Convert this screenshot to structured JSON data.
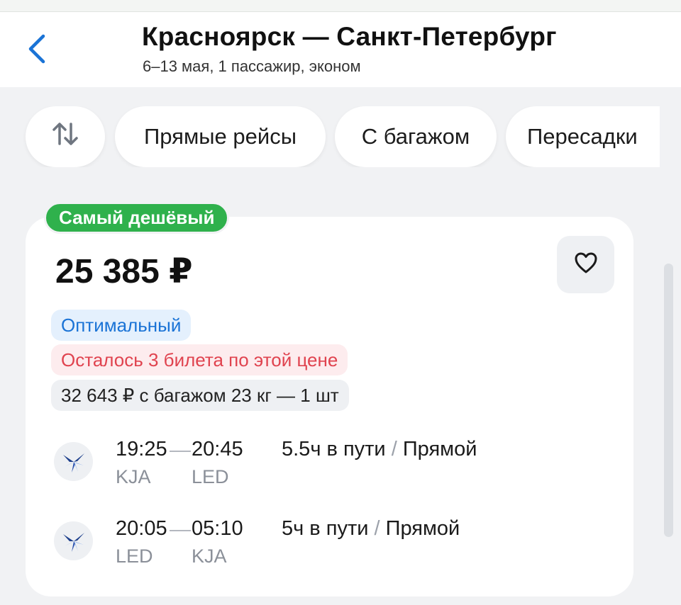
{
  "header": {
    "title": "Красноярск — Санкт-Петербург",
    "subtitle": "6–13 мая, 1 пассажир, эконом",
    "back_icon": "chevron-left-icon"
  },
  "filters": {
    "sort_icon": "sort-arrows-icon",
    "chips": [
      "Прямые рейсы",
      "С багажом",
      "Пересадки"
    ]
  },
  "offer": {
    "badge": "Самый дешёвый",
    "price": "25 385 ₽",
    "favorite_icon": "heart-icon",
    "tags": {
      "optimal": "Оптимальный",
      "tickets_left": "Осталось 3 билета по этой цене",
      "baggage_price": "32 643 ₽ с багажом 23 кг — 1 шт"
    },
    "flights": [
      {
        "dep_time": "19:25",
        "arr_time": "20:45",
        "dep_code": "KJA",
        "arr_code": "LED",
        "duration": "5.5ч в пути",
        "separator": "/",
        "type": "Прямой"
      },
      {
        "dep_time": "20:05",
        "arr_time": "05:10",
        "dep_code": "LED",
        "arr_code": "KJA",
        "duration": "5ч в пути",
        "separator": "/",
        "type": "Прямой"
      }
    ]
  },
  "colors": {
    "accent_blue": "#1a73d6",
    "badge_green": "#2fb14c",
    "warning_red": "#e0434f",
    "background": "#f1f2f4"
  }
}
